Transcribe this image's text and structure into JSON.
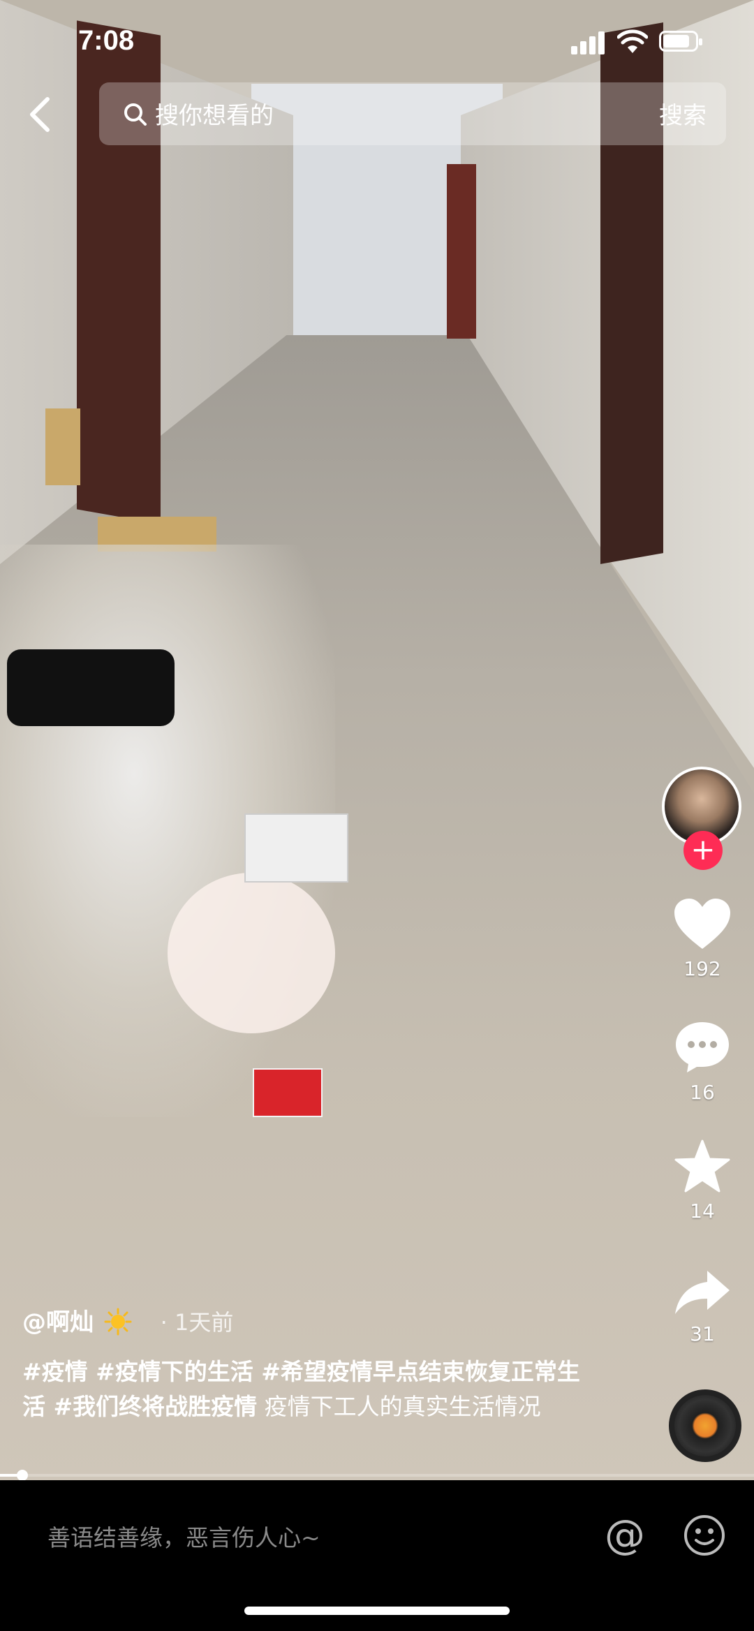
{
  "status": {
    "time": "7:08",
    "battery_level": 0.85
  },
  "search": {
    "placeholder": "搜你想看的",
    "button": "搜索"
  },
  "actions": {
    "like_count": "192",
    "comment_count": "16",
    "favorite_count": "14",
    "share_count": "31",
    "follow_symbol": "+"
  },
  "caption": {
    "author": "@啊灿",
    "time_ago": "· 1天前",
    "hashtags": "#疫情 #疫情下的生活 #希望疫情早点结束恢复正常生活 #我们终将战胜疫情",
    "text": " 疫情下工人的真实生活情况"
  },
  "playback": {
    "progress": 0.03
  },
  "comment": {
    "placeholder": "善语结善缘，恶言伤人心~",
    "at_symbol": "@"
  },
  "icons": [
    "back-icon",
    "search-icon",
    "heart-icon",
    "comment-icon",
    "star-icon",
    "share-icon",
    "music-disc-icon",
    "at-icon",
    "emoji-icon",
    "sun-icon"
  ],
  "colors": {
    "accent": "#fe2c55",
    "background": "#000000"
  }
}
